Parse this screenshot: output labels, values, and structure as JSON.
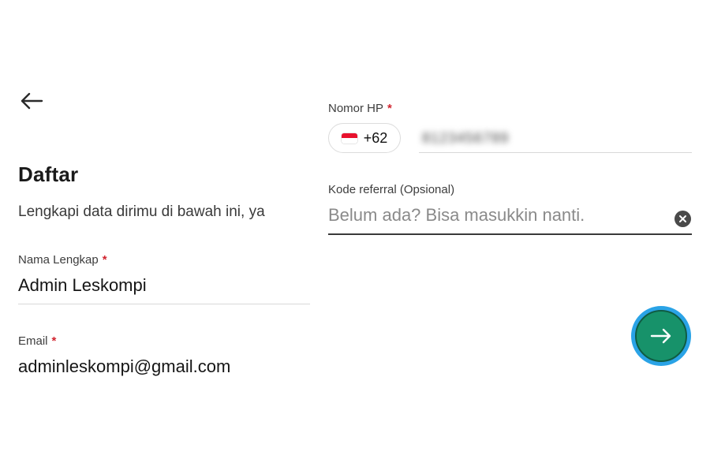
{
  "header": {
    "back_icon": "arrow-left-icon",
    "title": "Daftar",
    "subtitle": "Lengkapi data dirimu di bawah ini, ya"
  },
  "form": {
    "full_name": {
      "label": "Nama Lengkap",
      "required_mark": "*",
      "value": "Admin Leskompi"
    },
    "email": {
      "label": "Email",
      "required_mark": "*",
      "value": "adminleskompi@gmail.com"
    },
    "phone": {
      "label": "Nomor HP",
      "required_mark": "*",
      "country_flag": "indonesia-flag-icon",
      "country_code": "+62",
      "value": "8123456789"
    },
    "referral": {
      "label": "Kode referral (Opsional)",
      "placeholder": "Belum ada? Bisa masukkin nanti.",
      "clear_icon": "close-circle-icon"
    }
  },
  "actions": {
    "next_icon": "arrow-right-icon"
  },
  "colors": {
    "required": "#d1242f",
    "next_button": "#17926a",
    "focus_ring": "#2aa3e6"
  }
}
